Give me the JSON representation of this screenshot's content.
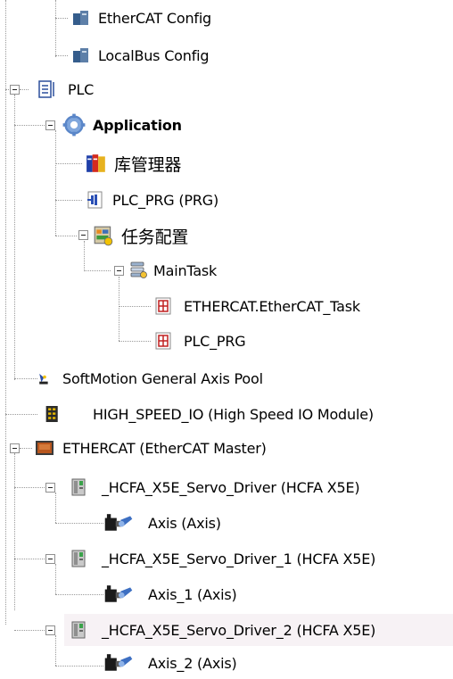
{
  "tree": {
    "ethercat_config": "EtherCAT Config",
    "localbus_config": "LocalBus Config",
    "plc": "PLC",
    "application": "Application",
    "library_manager": "库管理器",
    "plc_prg_prg": "PLC_PRG (PRG)",
    "task_config": "任务配置",
    "main_task": "MainTask",
    "ethercat_task": "ETHERCAT.EtherCAT_Task",
    "plc_prg": "PLC_PRG",
    "softmotion_pool": "SoftMotion General Axis Pool",
    "high_speed_io": "HIGH_SPEED_IO (High Speed IO Module)",
    "ethercat_master": "ETHERCAT (EtherCAT Master)",
    "servo_driver": "_HCFA_X5E_Servo_Driver (HCFA X5E)",
    "axis": "Axis (Axis)",
    "servo_driver_1": "_HCFA_X5E_Servo_Driver_1 (HCFA X5E)",
    "axis_1": "Axis_1 (Axis)",
    "servo_driver_2": "_HCFA_X5E_Servo_Driver_2 (HCFA X5E)",
    "axis_2": "Axis_2 (Axis)"
  },
  "icons": {
    "device_config": "device-config-icon",
    "plc": "plc-icon",
    "application": "application-gear-icon",
    "library": "library-books-icon",
    "pou": "pou-program-icon",
    "task_config": "task-config-icon",
    "task": "task-icon",
    "task_pou": "task-pou-icon",
    "softmotion": "softmotion-pool-icon",
    "io_module": "io-module-icon",
    "ethercat_master": "ethercat-master-icon",
    "slave": "ethercat-slave-icon",
    "axis": "axis-icon"
  }
}
